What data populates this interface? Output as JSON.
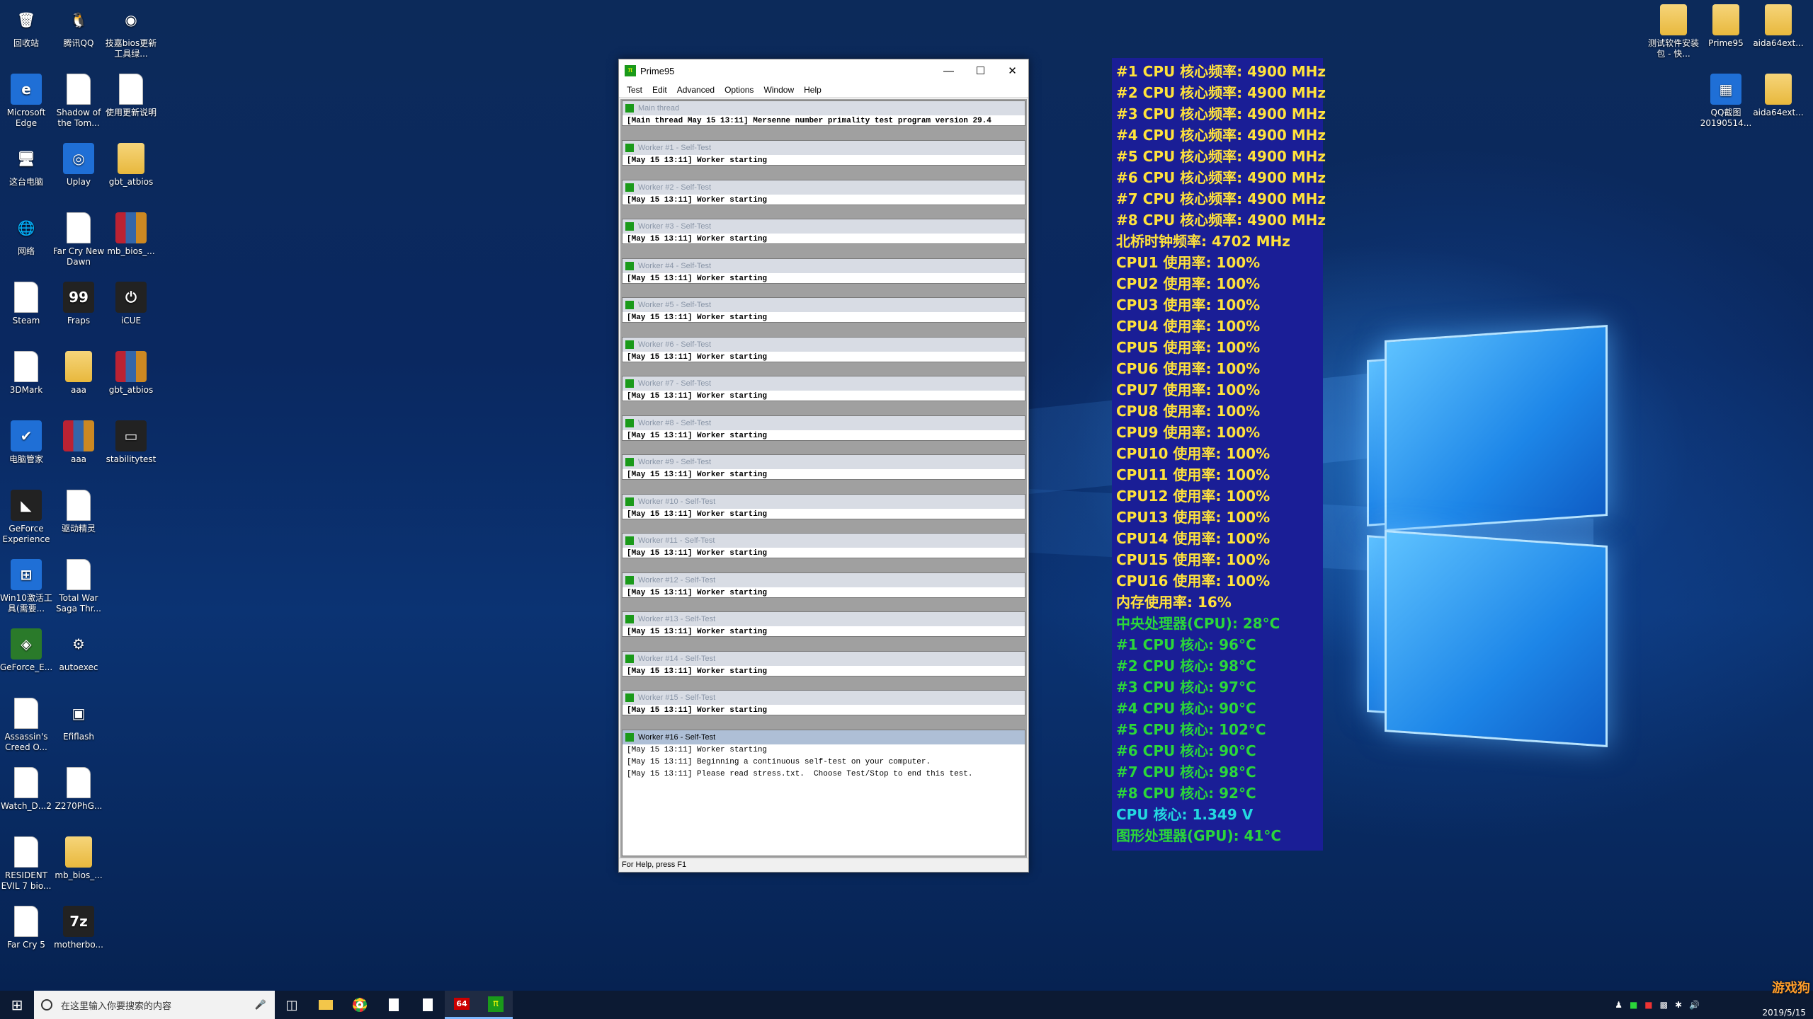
{
  "desktop_icons_left": [
    {
      "label": "回收站",
      "icon": "recycle-bin-icon",
      "col": 0,
      "row": 0
    },
    {
      "label": "腾讯QQ",
      "icon": "qq-icon",
      "col": 1,
      "row": 0
    },
    {
      "label": "技嘉bios更新工具绿...",
      "icon": "chrome-icon",
      "col": 2,
      "row": 0
    },
    {
      "label": "Microsoft Edge",
      "icon": "edge-icon",
      "col": 0,
      "row": 1
    },
    {
      "label": "Shadow of the Tom...",
      "icon": "document-icon",
      "col": 1,
      "row": 1
    },
    {
      "label": "使用更新说明",
      "icon": "document-icon",
      "col": 2,
      "row": 1
    },
    {
      "label": "这台电脑",
      "icon": "computer-icon",
      "col": 0,
      "row": 2
    },
    {
      "label": "Uplay",
      "icon": "uplay-icon",
      "col": 1,
      "row": 2
    },
    {
      "label": "gbt_atbios",
      "icon": "folder-icon",
      "col": 2,
      "row": 2
    },
    {
      "label": "网络",
      "icon": "network-icon",
      "col": 0,
      "row": 3
    },
    {
      "label": "Far Cry New Dawn",
      "icon": "document-icon",
      "col": 1,
      "row": 3
    },
    {
      "label": "mb_bios_...",
      "icon": "winrar-icon",
      "col": 2,
      "row": 3
    },
    {
      "label": "Steam",
      "icon": "document-icon",
      "col": 0,
      "row": 4
    },
    {
      "label": "Fraps",
      "icon": "fraps-icon",
      "col": 1,
      "row": 4
    },
    {
      "label": "iCUE",
      "icon": "icue-icon",
      "col": 2,
      "row": 4
    },
    {
      "label": "3DMark",
      "icon": "document-icon",
      "col": 0,
      "row": 5
    },
    {
      "label": "aaa",
      "icon": "folder-icon",
      "col": 1,
      "row": 5
    },
    {
      "label": "gbt_atbios",
      "icon": "winrar-icon",
      "col": 2,
      "row": 5
    },
    {
      "label": "电脑管家",
      "icon": "shield-icon",
      "col": 0,
      "row": 6
    },
    {
      "label": "aaa",
      "icon": "winrar-icon",
      "col": 1,
      "row": 6
    },
    {
      "label": "stabilitytest",
      "icon": "console-icon",
      "col": 2,
      "row": 6
    },
    {
      "label": "GeForce Experience",
      "icon": "geforce-icon",
      "col": 0,
      "row": 7
    },
    {
      "label": "驱动精灵",
      "icon": "document-icon",
      "col": 1,
      "row": 7
    },
    {
      "label": "Win10激活工具(需要...",
      "icon": "windows-icon",
      "col": 0,
      "row": 8
    },
    {
      "label": "Total War Saga Thr...",
      "icon": "document-icon",
      "col": 1,
      "row": 8
    },
    {
      "label": "GeForce_E...",
      "icon": "nvidia-icon",
      "col": 0,
      "row": 9
    },
    {
      "label": "autoexec",
      "icon": "settings-file-icon",
      "col": 1,
      "row": 9
    },
    {
      "label": "Assassin's Creed O...",
      "icon": "document-icon",
      "col": 0,
      "row": 10
    },
    {
      "label": "Efiflash",
      "icon": "app-icon",
      "col": 1,
      "row": 10
    },
    {
      "label": "Watch_D...2",
      "icon": "document-icon",
      "col": 0,
      "row": 11
    },
    {
      "label": "Z270PhG...",
      "icon": "document-icon",
      "col": 1,
      "row": 11
    },
    {
      "label": "RESIDENT EVIL 7 bio...",
      "icon": "document-icon",
      "col": 0,
      "row": 12
    },
    {
      "label": "mb_bios_...",
      "icon": "folder-icon",
      "col": 1,
      "row": 12
    },
    {
      "label": "Far Cry 5",
      "icon": "document-icon",
      "col": 0,
      "row": 13
    },
    {
      "label": "motherbo...",
      "icon": "7zip-icon",
      "col": 1,
      "row": 13
    }
  ],
  "desktop_icons_right": [
    {
      "label": "测试软件安装包 - 快...",
      "icon": "folder-icon"
    },
    {
      "label": "Prime95",
      "icon": "folder-icon"
    },
    {
      "label": "aida64ext...",
      "icon": "folder-icon"
    },
    {
      "label": "QQ截图20190514...",
      "icon": "image-icon"
    },
    {
      "label": "aida64ext...",
      "icon": "folder-icon"
    }
  ],
  "prime95": {
    "title": "Prime95",
    "menu": [
      "Test",
      "Edit",
      "Advanced",
      "Options",
      "Window",
      "Help"
    ],
    "main": {
      "title": "Main thread",
      "line": "[Main thread May 15 13:11] Mersenne number primality test program version 29.4"
    },
    "workers": [
      {
        "title": "Worker #1 - Self-Test",
        "line": "[May 15 13:11] Worker starting"
      },
      {
        "title": "Worker #2 - Self-Test",
        "line": "[May 15 13:11] Worker starting"
      },
      {
        "title": "Worker #3 - Self-Test",
        "line": "[May 15 13:11] Worker starting"
      },
      {
        "title": "Worker #4 - Self-Test",
        "line": "[May 15 13:11] Worker starting"
      },
      {
        "title": "Worker #5 - Self-Test",
        "line": "[May 15 13:11] Worker starting"
      },
      {
        "title": "Worker #6 - Self-Test",
        "line": "[May 15 13:11] Worker starting"
      },
      {
        "title": "Worker #7 - Self-Test",
        "line": "[May 15 13:11] Worker starting"
      },
      {
        "title": "Worker #8 - Self-Test",
        "line": "[May 15 13:11] Worker starting"
      },
      {
        "title": "Worker #9 - Self-Test",
        "line": "[May 15 13:11] Worker starting"
      },
      {
        "title": "Worker #10 - Self-Test",
        "line": "[May 15 13:11] Worker starting"
      },
      {
        "title": "Worker #11 - Self-Test",
        "line": "[May 15 13:11] Worker starting"
      },
      {
        "title": "Worker #12 - Self-Test",
        "line": "[May 15 13:11] Worker starting"
      },
      {
        "title": "Worker #13 - Self-Test",
        "line": "[May 15 13:11] Worker starting"
      },
      {
        "title": "Worker #14 - Self-Test",
        "line": "[May 15 13:11] Worker starting"
      },
      {
        "title": "Worker #15 - Self-Test",
        "line": "[May 15 13:11] Worker starting"
      }
    ],
    "active": {
      "title": "Worker #16 - Self-Test",
      "lines": [
        "[May 15 13:11] Worker starting",
        "[May 15 13:11] Beginning a continuous self-test on your computer.",
        "[May 15 13:11] Please read stress.txt.  Choose Test/Stop to end this test."
      ]
    },
    "status": "For Help, press F1"
  },
  "osd": [
    {
      "text": "#1 CPU 核心频率: 4900 MHz",
      "color": "yellow"
    },
    {
      "text": "#2 CPU 核心频率: 4900 MHz",
      "color": "yellow"
    },
    {
      "text": "#3 CPU 核心频率: 4900 MHz",
      "color": "yellow"
    },
    {
      "text": "#4 CPU 核心频率: 4900 MHz",
      "color": "yellow"
    },
    {
      "text": "#5 CPU 核心频率: 4900 MHz",
      "color": "yellow"
    },
    {
      "text": "#6 CPU 核心频率: 4900 MHz",
      "color": "yellow"
    },
    {
      "text": "#7 CPU 核心频率: 4900 MHz",
      "color": "yellow"
    },
    {
      "text": "#8 CPU 核心频率: 4900 MHz",
      "color": "yellow"
    },
    {
      "text": "北桥时钟频率: 4702 MHz",
      "color": "yellow"
    },
    {
      "text": "CPU1 使用率: 100%",
      "color": "yellow"
    },
    {
      "text": "CPU2 使用率: 100%",
      "color": "yellow"
    },
    {
      "text": "CPU3 使用率: 100%",
      "color": "yellow"
    },
    {
      "text": "CPU4 使用率: 100%",
      "color": "yellow"
    },
    {
      "text": "CPU5 使用率: 100%",
      "color": "yellow"
    },
    {
      "text": "CPU6 使用率: 100%",
      "color": "yellow"
    },
    {
      "text": "CPU7 使用率: 100%",
      "color": "yellow"
    },
    {
      "text": "CPU8 使用率: 100%",
      "color": "yellow"
    },
    {
      "text": "CPU9 使用率: 100%",
      "color": "yellow"
    },
    {
      "text": "CPU10 使用率: 100%",
      "color": "yellow"
    },
    {
      "text": "CPU11 使用率: 100%",
      "color": "yellow"
    },
    {
      "text": "CPU12 使用率: 100%",
      "color": "yellow"
    },
    {
      "text": "CPU13 使用率: 100%",
      "color": "yellow"
    },
    {
      "text": "CPU14 使用率: 100%",
      "color": "yellow"
    },
    {
      "text": "CPU15 使用率: 100%",
      "color": "yellow"
    },
    {
      "text": "CPU16 使用率: 100%",
      "color": "yellow"
    },
    {
      "text": "内存使用率: 16%",
      "color": "yellow"
    },
    {
      "text": "中央处理器(CPU): 28°C",
      "color": "green"
    },
    {
      "text": " #1 CPU 核心: 96°C",
      "color": "green"
    },
    {
      "text": " #2 CPU 核心: 98°C",
      "color": "green"
    },
    {
      "text": " #3 CPU 核心: 97°C",
      "color": "green"
    },
    {
      "text": " #4 CPU 核心: 90°C",
      "color": "green"
    },
    {
      "text": " #5 CPU 核心: 102°C",
      "color": "green"
    },
    {
      "text": " #6 CPU 核心: 90°C",
      "color": "green"
    },
    {
      "text": " #7 CPU 核心: 98°C",
      "color": "green"
    },
    {
      "text": " #8 CPU 核心: 92°C",
      "color": "green"
    },
    {
      "text": "CPU 核心: 1.349 V",
      "color": "cyan"
    },
    {
      "text": "图形处理器(GPU): 41°C",
      "color": "green"
    }
  ],
  "osd_colors": {
    "yellow": "#ffe23c",
    "green": "#2bd63a",
    "cyan": "#23d9e0",
    "background": "#1a1e96"
  },
  "taskbar": {
    "search_placeholder": "在这里输入你要搜索的内容",
    "apps": [
      "task-view-icon",
      "file-explorer-icon",
      "chrome-icon",
      "document-icon",
      "document-icon",
      "aida64-icon",
      "prime95-icon"
    ],
    "aida_label": "64"
  },
  "watermark": "游戏狗",
  "date": "2019/5/15"
}
